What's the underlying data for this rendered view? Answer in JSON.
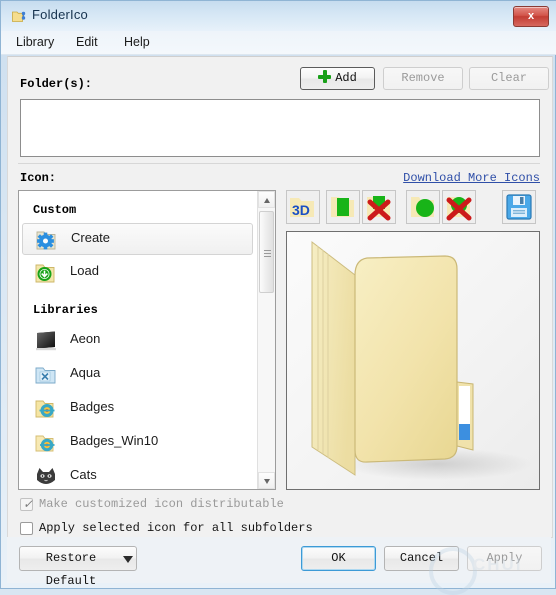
{
  "window": {
    "title": "FolderIco",
    "app_icon": "folder-app-icon",
    "close_label": "x"
  },
  "menubar": {
    "items": [
      {
        "label": "Library"
      },
      {
        "label": "Edit"
      },
      {
        "label": "Help"
      }
    ]
  },
  "folders_section": {
    "label": "Folder(s):",
    "buttons": [
      {
        "label": "Add",
        "icon": "plus-icon",
        "state": "enabled"
      },
      {
        "label": "Remove",
        "state": "disabled"
      },
      {
        "label": "Clear",
        "state": "disabled"
      }
    ],
    "list_value": ""
  },
  "icon_section": {
    "label": "Icon:",
    "download_link": "Download More Icons",
    "toolbar": [
      {
        "name": "3d-icon-button",
        "label": "3D"
      },
      {
        "name": "green-rect-icon-button",
        "label": ""
      },
      {
        "name": "red-x-rect-icon-button",
        "label": ""
      },
      {
        "name": "green-circle-icon-button",
        "label": ""
      },
      {
        "name": "red-x-circle-icon-button",
        "label": ""
      },
      {
        "name": "save-icon-button",
        "label": ""
      }
    ],
    "groups": [
      {
        "title": "Custom",
        "items": [
          {
            "label": "Create",
            "icon": "gear-folder-icon",
            "selected": true
          },
          {
            "label": "Load",
            "icon": "download-folder-icon",
            "selected": false
          }
        ]
      },
      {
        "title": "Libraries",
        "items": [
          {
            "label": "Aeon",
            "icon": "aeon-monitor-icon",
            "selected": false
          },
          {
            "label": "Aqua",
            "icon": "aqua-folder-icon",
            "selected": false
          },
          {
            "label": "Badges",
            "icon": "badges-folder-icon",
            "selected": false
          },
          {
            "label": "Badges_Win10",
            "icon": "badges-win10-folder-icon",
            "selected": false
          },
          {
            "label": "Cats",
            "icon": "cats-icon",
            "selected": false
          }
        ]
      }
    ],
    "preview_alt": "open-yellow-folder-preview"
  },
  "options": [
    {
      "label": "Make customized icon distributable",
      "checked": true,
      "enabled": false
    },
    {
      "label": "Apply selected icon for all subfolders",
      "checked": false,
      "enabled": true
    }
  ],
  "footer": {
    "restore_default": "Restore Default",
    "ok": "OK",
    "cancel": "Cancel",
    "apply": "Apply",
    "watermark": "CHUI"
  },
  "colors": {
    "titlebar_top": "#c6dcef",
    "accent_link": "#2f4fa8",
    "close_red": "#c33c33",
    "plus_green": "#19a019",
    "folder_yellow": "#f4e3a1",
    "focus_blue": "#3c9ad6"
  }
}
